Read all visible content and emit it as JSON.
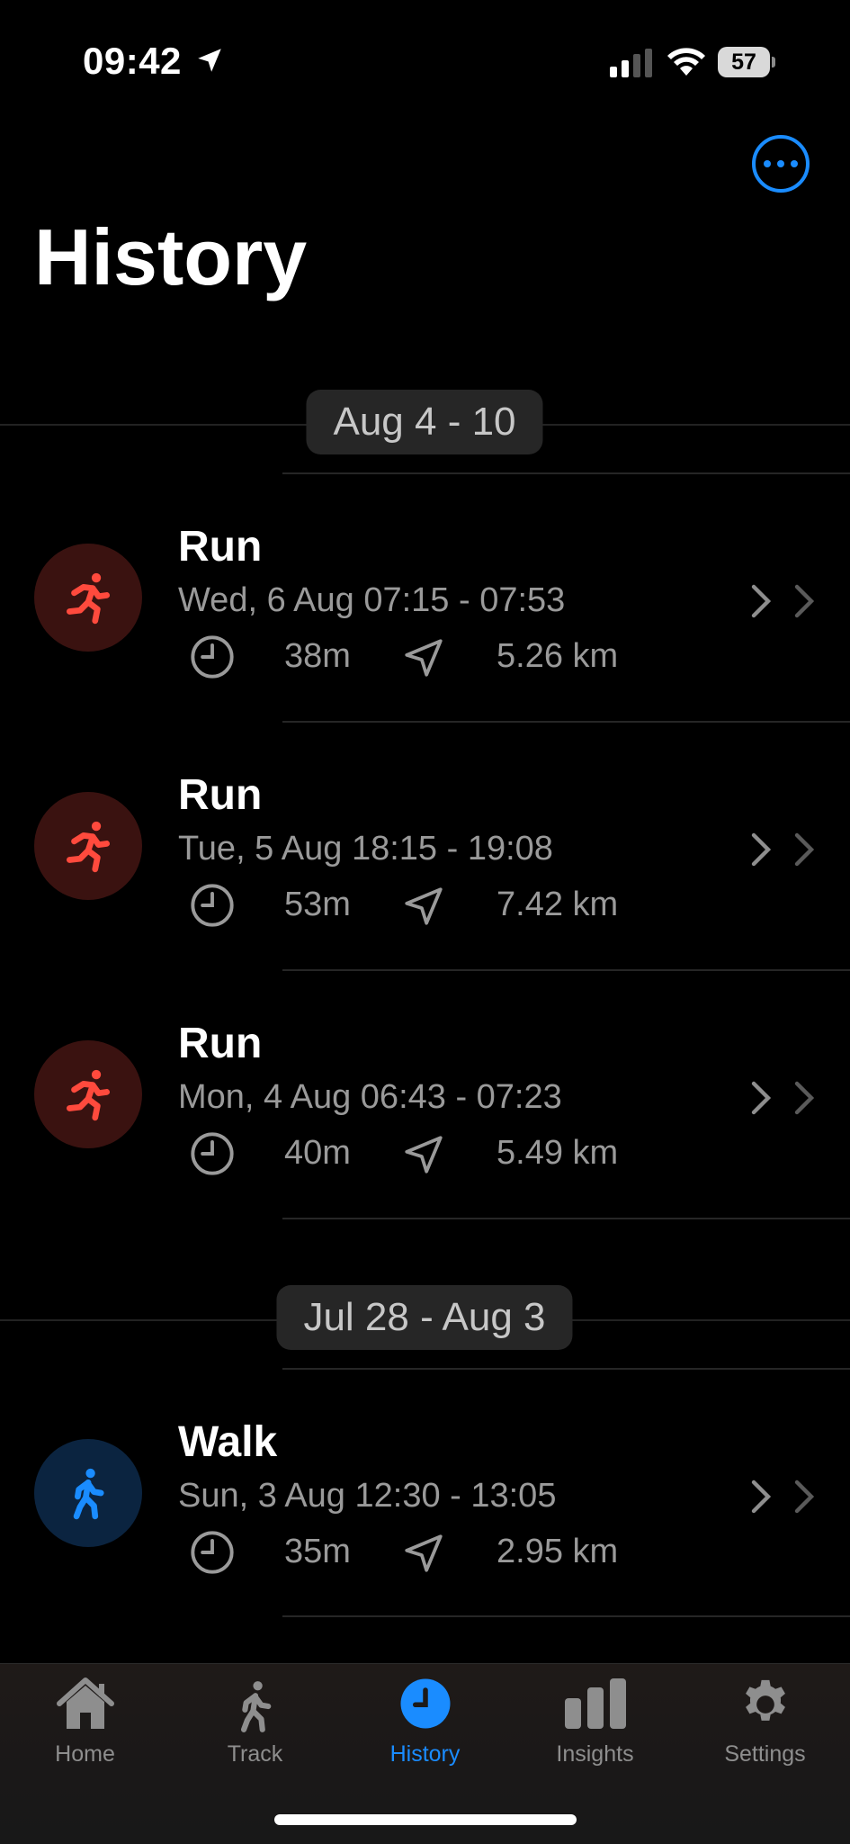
{
  "status_bar": {
    "time": "09:42",
    "battery": "57"
  },
  "header": {
    "title": "History",
    "more_icon": "ellipsis-circle-icon",
    "accent_color": "#1a8cff"
  },
  "groups": [
    {
      "week_label": "Aug 4 - 10",
      "activities": [
        {
          "type": "Run",
          "date": "Wed, 6 Aug 07:15 - 07:53",
          "duration": "38m",
          "distance": "5.26 km"
        },
        {
          "type": "Run",
          "date": "Tue, 5 Aug 18:15 - 19:08",
          "duration": "53m",
          "distance": "7.42 km"
        },
        {
          "type": "Run",
          "date": "Mon, 4 Aug 06:43 - 07:23",
          "duration": "40m",
          "distance": "5.49 km"
        }
      ]
    },
    {
      "week_label": "Jul 28 - Aug 3",
      "activities": [
        {
          "type": "Walk",
          "date": "Sun, 3 Aug 12:30 - 13:05",
          "duration": "35m",
          "distance": "2.95 km"
        }
      ]
    }
  ],
  "colors": {
    "run": "#ff4a3d",
    "walk": "#1a8cff"
  },
  "tab_bar": {
    "tabs": [
      {
        "label": "Home",
        "icon": "house-icon"
      },
      {
        "label": "Track",
        "icon": "walking-figure-icon"
      },
      {
        "label": "History",
        "icon": "clock-icon",
        "active": true
      },
      {
        "label": "Insights",
        "icon": "bar-chart-icon"
      },
      {
        "label": "Settings",
        "icon": "gear-icon"
      }
    ]
  }
}
